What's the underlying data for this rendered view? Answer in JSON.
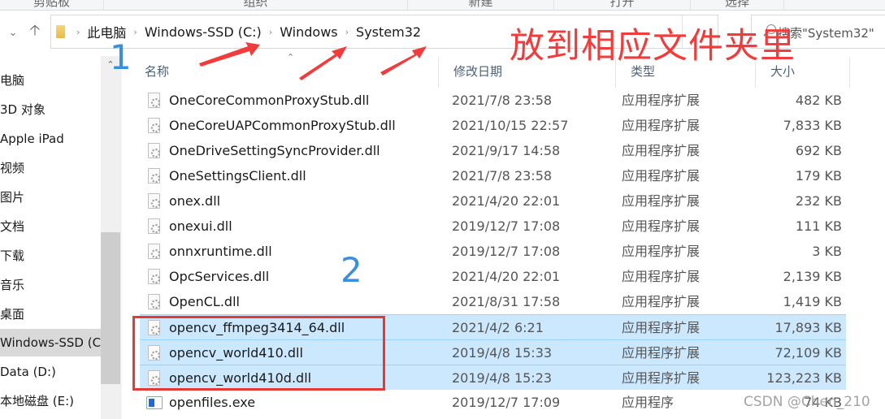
{
  "ribbon": {
    "groups": [
      "剪贴板",
      "组织",
      "新建",
      "打开",
      "选择"
    ]
  },
  "nav": {
    "recent_icon": "chevron-down-icon",
    "up_icon": "arrow-up-icon",
    "breadcrumb": [
      "此电脑",
      "Windows-SSD (C:)",
      "Windows",
      "System32"
    ],
    "search_placeholder": "搜索\"System32\""
  },
  "sidebar": {
    "items": [
      {
        "label": "此电脑",
        "active": false
      },
      {
        "label": "3D 对象",
        "active": false
      },
      {
        "label": "Apple iPad",
        "active": false
      },
      {
        "label": "视频",
        "active": false
      },
      {
        "label": "图片",
        "active": false
      },
      {
        "label": "文档",
        "active": false
      },
      {
        "label": "下载",
        "active": false
      },
      {
        "label": "音乐",
        "active": false
      },
      {
        "label": "桌面",
        "active": false
      },
      {
        "label": "Windows-SSD (C:)",
        "active": true
      },
      {
        "label": "Data (D:)",
        "active": false
      },
      {
        "label": "本地磁盘 (E:)",
        "active": false
      }
    ]
  },
  "columns": {
    "name": "名称",
    "date": "修改日期",
    "type": "类型",
    "size": "大小"
  },
  "files": [
    {
      "name": "OneCoreCommonProxyStub.dll",
      "date": "2021/7/8 23:58",
      "type": "应用程序扩展",
      "size": "482 KB",
      "selected": false,
      "icon": "dll"
    },
    {
      "name": "OneCoreUAPCommonProxyStub.dll",
      "date": "2021/10/15 22:57",
      "type": "应用程序扩展",
      "size": "7,833 KB",
      "selected": false,
      "icon": "dll"
    },
    {
      "name": "OneDriveSettingSyncProvider.dll",
      "date": "2021/9/17 14:58",
      "type": "应用程序扩展",
      "size": "692 KB",
      "selected": false,
      "icon": "dll"
    },
    {
      "name": "OneSettingsClient.dll",
      "date": "2021/7/8 23:58",
      "type": "应用程序扩展",
      "size": "179 KB",
      "selected": false,
      "icon": "dll"
    },
    {
      "name": "onex.dll",
      "date": "2021/4/20 22:01",
      "type": "应用程序扩展",
      "size": "232 KB",
      "selected": false,
      "icon": "dll"
    },
    {
      "name": "onexui.dll",
      "date": "2019/12/7 17:08",
      "type": "应用程序扩展",
      "size": "111 KB",
      "selected": false,
      "icon": "dll"
    },
    {
      "name": "onnxruntime.dll",
      "date": "2019/12/7 17:08",
      "type": "应用程序扩展",
      "size": "3 KB",
      "selected": false,
      "icon": "dll"
    },
    {
      "name": "OpcServices.dll",
      "date": "2021/4/20 22:01",
      "type": "应用程序扩展",
      "size": "2,139 KB",
      "selected": false,
      "icon": "dll"
    },
    {
      "name": "OpenCL.dll",
      "date": "2021/8/31 17:58",
      "type": "应用程序扩展",
      "size": "1,419 KB",
      "selected": false,
      "icon": "dll"
    },
    {
      "name": "opencv_ffmpeg3414_64.dll",
      "date": "2021/4/2 6:21",
      "type": "应用程序扩展",
      "size": "17,893 KB",
      "selected": true,
      "icon": "dll"
    },
    {
      "name": "opencv_world410.dll",
      "date": "2019/4/8 15:33",
      "type": "应用程序扩展",
      "size": "72,109 KB",
      "selected": true,
      "icon": "dll"
    },
    {
      "name": "opencv_world410d.dll",
      "date": "2019/4/8 15:23",
      "type": "应用程序扩展",
      "size": "123,223 KB",
      "selected": true,
      "icon": "dll"
    },
    {
      "name": "openfiles.exe",
      "date": "2019/12/7 17:09",
      "type": "应用程序",
      "size": "74 KB",
      "selected": false,
      "icon": "exe"
    }
  ],
  "annotations": {
    "instruction": "放到相应文件夹里",
    "step1": "1",
    "step2": "2",
    "color_red": "#f23b3b",
    "color_blue": "#3a8ee0"
  },
  "watermark": "CSDN @Chen_210"
}
